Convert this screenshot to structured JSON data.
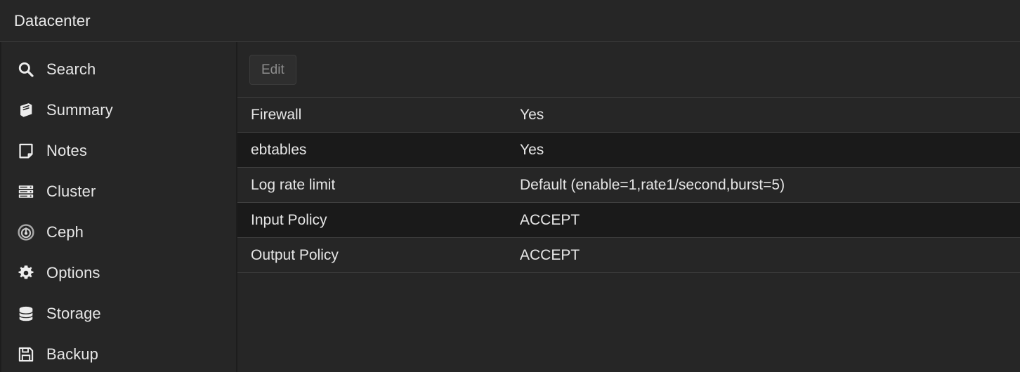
{
  "header": {
    "title": "Datacenter"
  },
  "colors": {
    "app_background": "#262626",
    "row_alt_background": "#1a1a1a",
    "divider": "#3f3f3f",
    "text": "#e6e6e6",
    "disabled_text": "#8d8d8d",
    "button_background": "#2e2e2e"
  },
  "sidebar": {
    "items": [
      {
        "label": "Search",
        "icon": "search-icon"
      },
      {
        "label": "Summary",
        "icon": "book-icon"
      },
      {
        "label": "Notes",
        "icon": "note-icon"
      },
      {
        "label": "Cluster",
        "icon": "server-rack-icon"
      },
      {
        "label": "Ceph",
        "icon": "ceph-icon"
      },
      {
        "label": "Options",
        "icon": "gear-icon"
      },
      {
        "label": "Storage",
        "icon": "database-icon"
      },
      {
        "label": "Backup",
        "icon": "floppy-disk-icon"
      }
    ]
  },
  "toolbar": {
    "edit_label": "Edit",
    "edit_disabled": true
  },
  "table": {
    "rows": [
      {
        "key": "Firewall",
        "value": "Yes"
      },
      {
        "key": "ebtables",
        "value": "Yes"
      },
      {
        "key": "Log rate limit",
        "value": "Default (enable=1,rate1/second,burst=5)"
      },
      {
        "key": "Input Policy",
        "value": "ACCEPT"
      },
      {
        "key": "Output Policy",
        "value": "ACCEPT"
      }
    ]
  }
}
